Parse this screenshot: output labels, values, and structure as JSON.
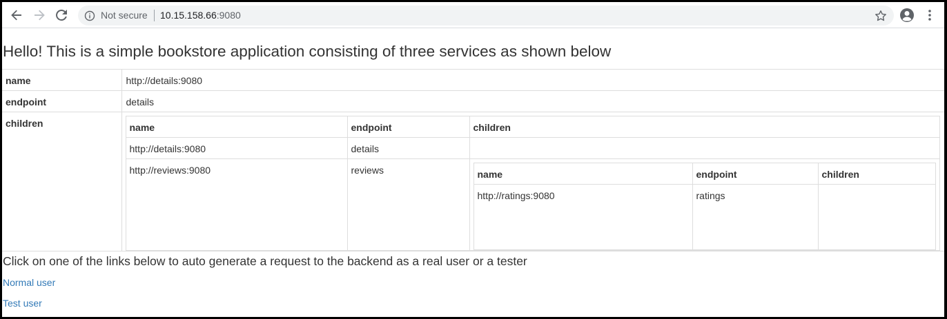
{
  "browser": {
    "security_label": "Not secure",
    "url_host": "10.15.158.66",
    "url_port": ":9080"
  },
  "page": {
    "heading": "Hello! This is a simple bookstore application consisting of three services as shown below",
    "top_table": {
      "name_key": "name",
      "name_value": "http://details:9080",
      "endpoint_key": "endpoint",
      "endpoint_value": "details",
      "children_key": "children"
    },
    "children_table": {
      "headers": [
        "name",
        "endpoint",
        "children"
      ],
      "rows": [
        {
          "name": "http://details:9080",
          "endpoint": "details"
        },
        {
          "name": "http://reviews:9080",
          "endpoint": "reviews"
        }
      ],
      "nested": {
        "headers": [
          "name",
          "endpoint",
          "children"
        ],
        "rows": [
          {
            "name": "http://ratings:9080",
            "endpoint": "ratings",
            "children": ""
          }
        ]
      }
    },
    "instructions": "Click on one of the links below to auto generate a request to the backend as a real user or a tester",
    "links": [
      "Normal user",
      "Test user"
    ]
  }
}
